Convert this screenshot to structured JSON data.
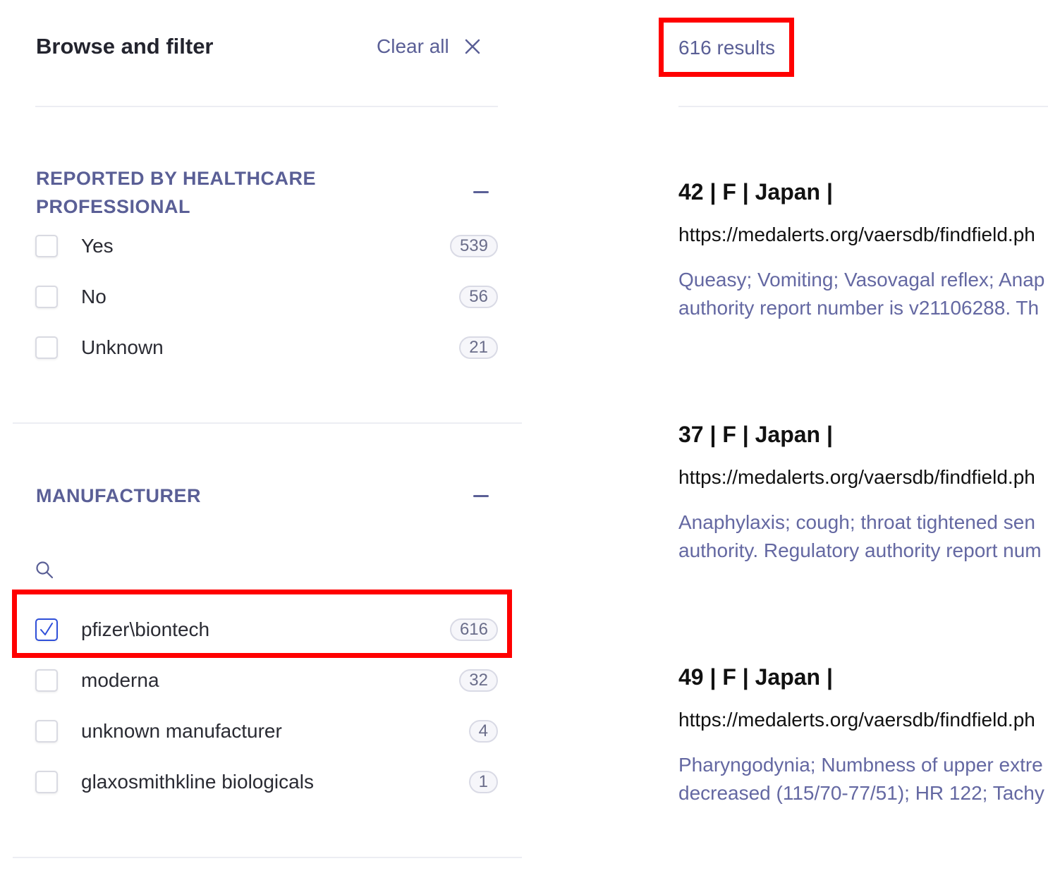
{
  "sidebar": {
    "title": "Browse and filter",
    "clear_all_label": "Clear all",
    "facets": [
      {
        "heading_line1": "REPORTED BY HEALTHCARE",
        "heading_line2": "PROFESSIONAL",
        "options": [
          {
            "label": "Yes",
            "count": "539",
            "checked": false
          },
          {
            "label": "No",
            "count": "56",
            "checked": false
          },
          {
            "label": "Unknown",
            "count": "21",
            "checked": false
          }
        ]
      },
      {
        "heading_line1": "MANUFACTURER",
        "options": [
          {
            "label": "pfizer\\biontech",
            "count": "616",
            "checked": true
          },
          {
            "label": "moderna",
            "count": "32",
            "checked": false
          },
          {
            "label": "unknown manufacturer",
            "count": "4",
            "checked": false
          },
          {
            "label": "glaxosmithkline biologicals",
            "count": "1",
            "checked": false
          }
        ]
      }
    ]
  },
  "results": {
    "count_label": "616 results",
    "items": [
      {
        "title": "42 | F | Japan |",
        "url": "https://medalerts.org/vaersdb/findfield.ph",
        "snippet_line1": "Queasy; Vomiting; Vasovagal reflex; Anap",
        "snippet_line2": "authority report number is v21106288. Th"
      },
      {
        "title": "37 | F | Japan |",
        "url": "https://medalerts.org/vaersdb/findfield.ph",
        "snippet_line1": "Anaphylaxis; cough; throat tightened sen",
        "snippet_line2": "authority. Regulatory authority report num"
      },
      {
        "title": "49 | F | Japan |",
        "url": "https://medalerts.org/vaersdb/findfield.ph",
        "snippet_line1": "Pharyngodynia; Numbness of upper extre",
        "snippet_line2": "decreased (115/70-77/51); HR 122; Tachy"
      }
    ]
  },
  "colors": {
    "accent": "#5a5f96",
    "highlight": "#ff0000",
    "checkbox_checked": "#2f4fd9"
  }
}
